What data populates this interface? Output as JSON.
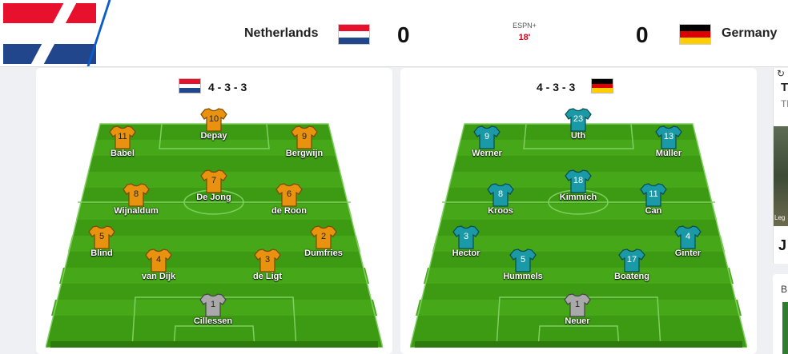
{
  "header": {
    "home": {
      "name": "Netherlands",
      "score": "0",
      "flag_colors": [
        "#e8112d",
        "#ffffff",
        "#21468b"
      ]
    },
    "away": {
      "name": "Germany",
      "score": "0",
      "flag_colors": [
        "#000000",
        "#dd0000",
        "#ffce00"
      ]
    },
    "network": "ESPN+",
    "clock": "18'"
  },
  "lineups": {
    "home": {
      "formation": "4 - 3 - 3",
      "jersey_color": "#e8920f",
      "players": [
        {
          "number": "10",
          "name": "Depay"
        },
        {
          "number": "11",
          "name": "Babel"
        },
        {
          "number": "9",
          "name": "Bergwijn"
        },
        {
          "number": "7",
          "name": "De Jong"
        },
        {
          "number": "8",
          "name": "Wijnaldum"
        },
        {
          "number": "6",
          "name": "de Roon"
        },
        {
          "number": "5",
          "name": "Blind"
        },
        {
          "number": "2",
          "name": "Dumfries"
        },
        {
          "number": "4",
          "name": "van Dijk"
        },
        {
          "number": "3",
          "name": "de Ligt"
        },
        {
          "number": "1",
          "name": "Cillessen"
        }
      ]
    },
    "away": {
      "formation": "4 - 3 - 3",
      "jersey_color": "#1a9aa6",
      "players": [
        {
          "number": "23",
          "name": "Uth"
        },
        {
          "number": "9",
          "name": "Werner"
        },
        {
          "number": "13",
          "name": "Müller"
        },
        {
          "number": "18",
          "name": "Kimmich"
        },
        {
          "number": "8",
          "name": "Kroos"
        },
        {
          "number": "11",
          "name": "Can"
        },
        {
          "number": "3",
          "name": "Hector"
        },
        {
          "number": "4",
          "name": "Ginter"
        },
        {
          "number": "5",
          "name": "Hummels"
        },
        {
          "number": "17",
          "name": "Boateng"
        },
        {
          "number": "1",
          "name": "Neuer"
        }
      ]
    },
    "goalkeeper_color": "#a9a9a9"
  },
  "sidebar": {
    "card1_title": "T",
    "card1_sub": "Th",
    "card1_caption": "Leg",
    "card1_letter": "J",
    "card2_title": "B"
  },
  "colors": {
    "pitch_dark": "#3c9a13",
    "pitch_light": "#46a818",
    "accent_red": "#d0021b"
  }
}
